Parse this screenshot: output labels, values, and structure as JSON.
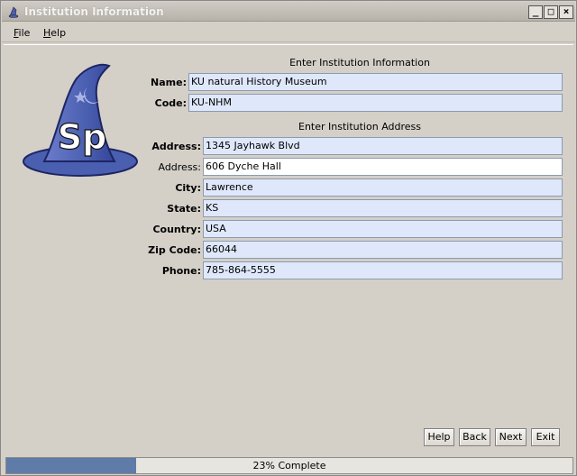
{
  "window": {
    "title": "Institution Information"
  },
  "menu": [
    {
      "label": "File",
      "mnemonic": "F",
      "rest": "ile"
    },
    {
      "label": "Help",
      "mnemonic": "H",
      "rest": "elp"
    }
  ],
  "logo": {
    "text": "Sp"
  },
  "institution": {
    "header": "Enter Institution Information",
    "name_label": "Name:",
    "name_value": "KU natural History Museum",
    "code_label": "Code:",
    "code_value": "KU-NHM"
  },
  "address": {
    "header": "Enter Institution Address",
    "address1_label": "Address:",
    "address1_value": "1345 Jayhawk Blvd",
    "address2_label": "Address:",
    "address2_value": "606 Dyche Hall",
    "city_label": "City:",
    "city_value": "Lawrence",
    "state_label": "State:",
    "state_value": "KS",
    "country_label": "Country:",
    "country_value": "USA",
    "zip_label": "Zip Code:",
    "zip_value": "66044",
    "phone_label": "Phone:",
    "phone_value": "785-864-5555"
  },
  "buttons": {
    "help": "Help",
    "back": "Back",
    "next": "Next",
    "exit": "Exit"
  },
  "progress": {
    "value": 0.23,
    "text": "23% Complete"
  },
  "colors": {
    "field_required": "#dfe8fb",
    "field_optional": "#ffffff",
    "progress_fill": "#5f7ba8",
    "hat": "#4b5fb0"
  }
}
